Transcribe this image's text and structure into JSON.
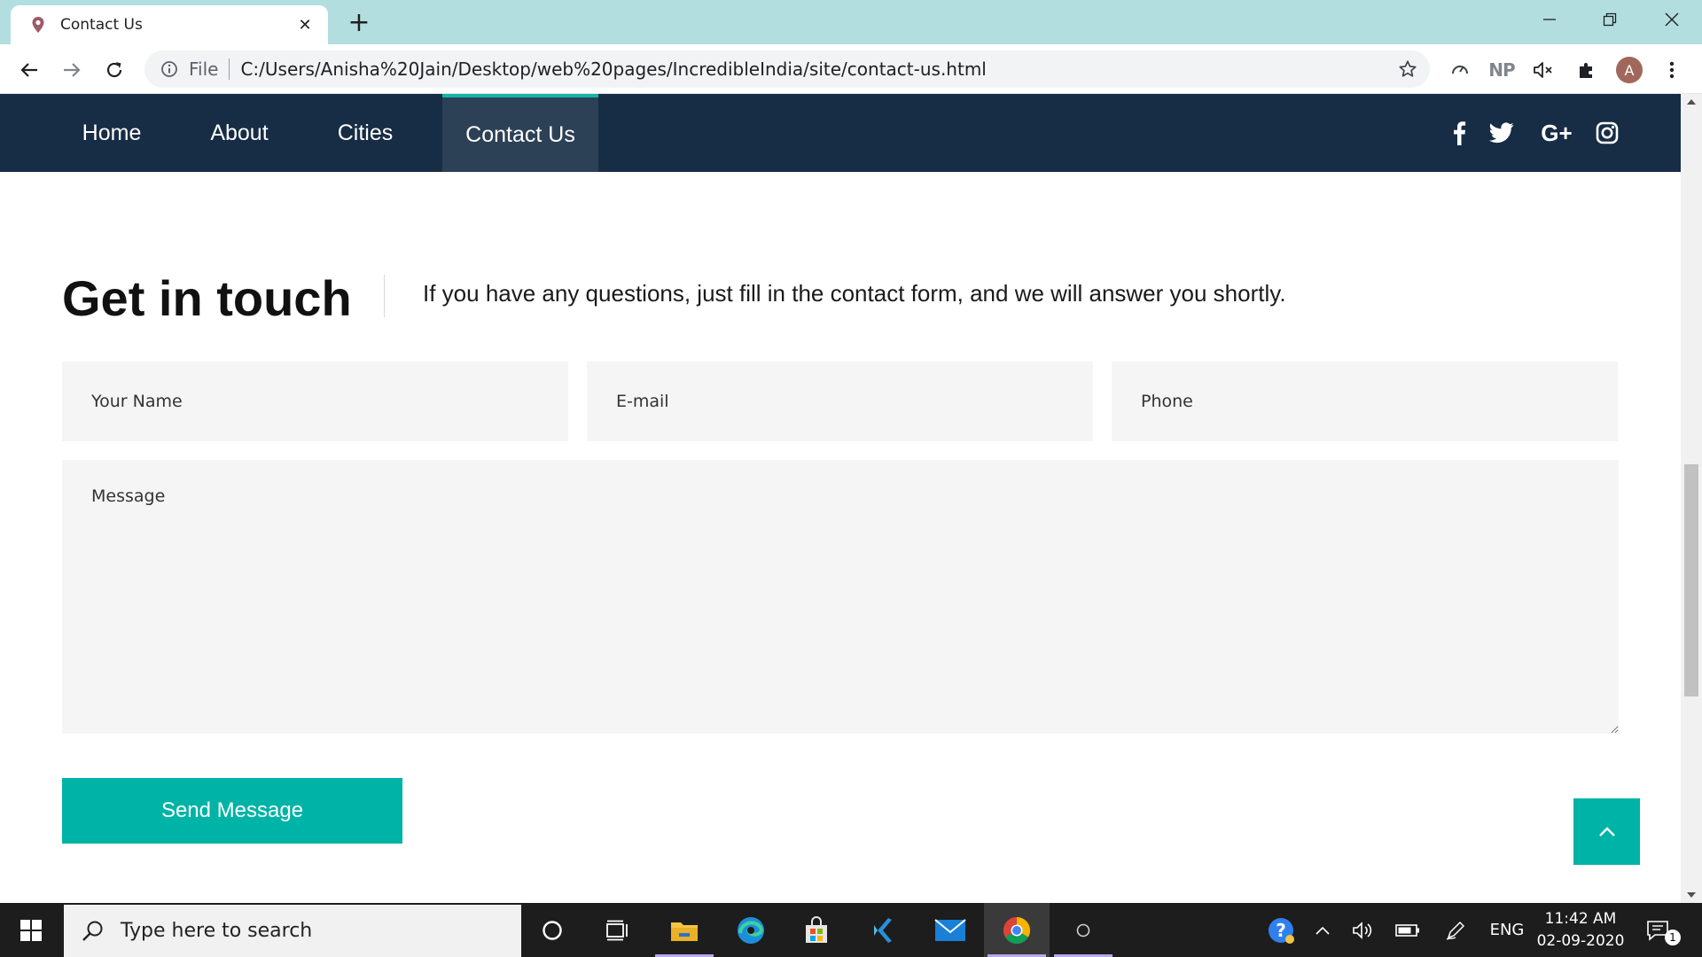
{
  "browser": {
    "tab_title": "Contact Us",
    "tab_close": "✕",
    "new_tab": "+",
    "file_label": "File",
    "url": "C:/Users/Anisha%20Jain/Desktop/web%20pages/IncredibleIndia/site/contact-us.html",
    "extension_np": "NP",
    "avatar_letter": "A"
  },
  "nav": {
    "items": [
      {
        "label": "Home",
        "active": false
      },
      {
        "label": "About",
        "active": false
      },
      {
        "label": "Cities",
        "active": false
      },
      {
        "label": "Contact Us",
        "active": true
      }
    ],
    "social": [
      "facebook-icon",
      "twitter-icon",
      "google-plus-icon",
      "instagram-icon"
    ],
    "google_plus_label": "G+",
    "facebook_label": "f"
  },
  "contact": {
    "heading": "Get in touch",
    "lead": "If you have any questions, just fill in the contact form, and we will answer you shortly.",
    "name_placeholder": "Your Name",
    "email_placeholder": "E-mail",
    "phone_placeholder": "Phone",
    "message_placeholder": "Message",
    "send_label": "Send Message"
  },
  "taskbar": {
    "search_placeholder": "Type here to search",
    "language": "ENG",
    "time": "11:42 AM",
    "date": "02-09-2020",
    "notifications": "1"
  },
  "colors": {
    "nav_bg": "#172c45",
    "nav_active_bg": "#2c4056",
    "accent": "#00b3a7",
    "tabstrip_bg": "#b3dedf"
  }
}
